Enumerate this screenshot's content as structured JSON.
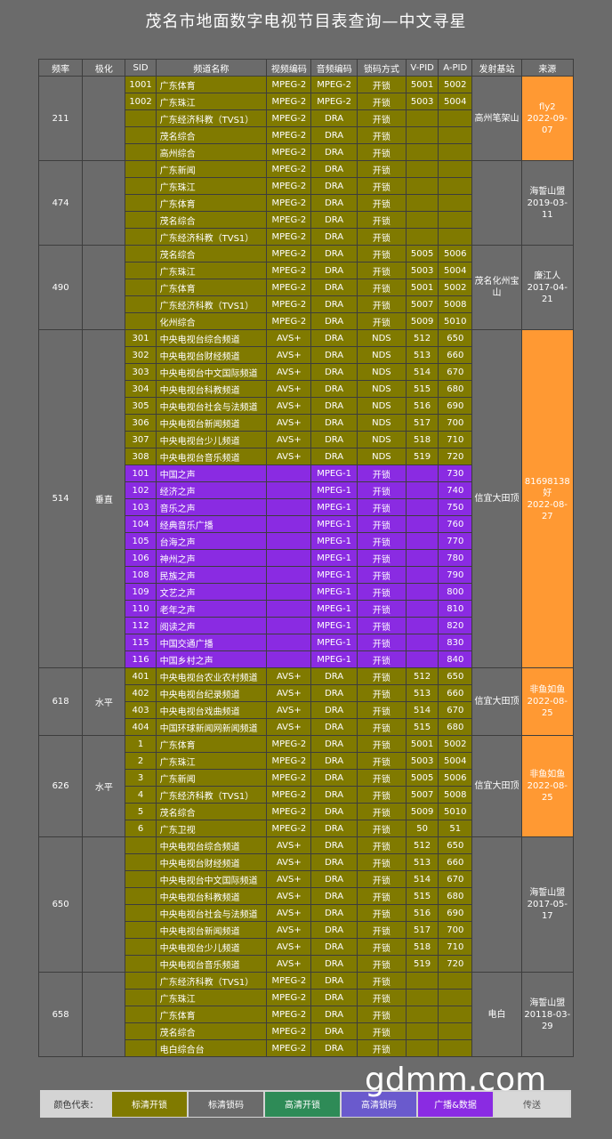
{
  "title": "茂名市地面数字电视节目表查询—中文寻星",
  "headers": [
    "频率",
    "极化",
    "SID",
    "频道名称",
    "视频编码",
    "音频编码",
    "锁码方式",
    "V-PID",
    "A-PID",
    "发射基站",
    "来源"
  ],
  "groups": [
    {
      "freq": "211",
      "pol": "",
      "site": "高州笔架山",
      "source": "fly2\n2022-09-07",
      "source_color": "orange",
      "rows": [
        {
          "t": "olive",
          "sid": "1001",
          "name": "广东体育",
          "v": "MPEG-2",
          "a": "MPEG-2",
          "lock": "开锁",
          "vpid": "5001",
          "apid": "5002"
        },
        {
          "t": "olive",
          "sid": "1002",
          "name": "广东珠江",
          "v": "MPEG-2",
          "a": "MPEG-2",
          "lock": "开锁",
          "vpid": "5003",
          "apid": "5004"
        },
        {
          "t": "olive",
          "sid": "",
          "name": "广东经济科教（TVS1）",
          "v": "MPEG-2",
          "a": "DRA",
          "lock": "开锁",
          "vpid": "",
          "apid": ""
        },
        {
          "t": "olive",
          "sid": "",
          "name": "茂名综合",
          "v": "MPEG-2",
          "a": "DRA",
          "lock": "开锁",
          "vpid": "",
          "apid": ""
        },
        {
          "t": "olive",
          "sid": "",
          "name": "高州综合",
          "v": "MPEG-2",
          "a": "DRA",
          "lock": "开锁",
          "vpid": "",
          "apid": ""
        }
      ]
    },
    {
      "freq": "474",
      "pol": "",
      "site": "",
      "source": "海誓山盟\n2019-03-11",
      "source_color": "gray",
      "rows": [
        {
          "t": "olive",
          "sid": "",
          "name": "广东新闻",
          "v": "MPEG-2",
          "a": "DRA",
          "lock": "开锁",
          "vpid": "",
          "apid": ""
        },
        {
          "t": "olive",
          "sid": "",
          "name": "广东珠江",
          "v": "MPEG-2",
          "a": "DRA",
          "lock": "开锁",
          "vpid": "",
          "apid": ""
        },
        {
          "t": "olive",
          "sid": "",
          "name": "广东体育",
          "v": "MPEG-2",
          "a": "DRA",
          "lock": "开锁",
          "vpid": "",
          "apid": ""
        },
        {
          "t": "olive",
          "sid": "",
          "name": "茂名综合",
          "v": "MPEG-2",
          "a": "DRA",
          "lock": "开锁",
          "vpid": "",
          "apid": ""
        },
        {
          "t": "olive",
          "sid": "",
          "name": "广东经济科教（TVS1）",
          "v": "MPEG-2",
          "a": "DRA",
          "lock": "开锁",
          "vpid": "",
          "apid": ""
        }
      ]
    },
    {
      "freq": "490",
      "pol": "",
      "site": "茂名化州宝山",
      "source": "廉江人\n2017-04-21",
      "source_color": "gray",
      "rows": [
        {
          "t": "olive",
          "sid": "",
          "name": "茂名综合",
          "v": "MPEG-2",
          "a": "DRA",
          "lock": "开锁",
          "vpid": "5005",
          "apid": "5006"
        },
        {
          "t": "olive",
          "sid": "",
          "name": "广东珠江",
          "v": "MPEG-2",
          "a": "DRA",
          "lock": "开锁",
          "vpid": "5003",
          "apid": "5004"
        },
        {
          "t": "olive",
          "sid": "",
          "name": "广东体育",
          "v": "MPEG-2",
          "a": "DRA",
          "lock": "开锁",
          "vpid": "5001",
          "apid": "5002"
        },
        {
          "t": "olive",
          "sid": "",
          "name": "广东经济科教（TVS1）",
          "v": "MPEG-2",
          "a": "DRA",
          "lock": "开锁",
          "vpid": "5007",
          "apid": "5008"
        },
        {
          "t": "olive",
          "sid": "",
          "name": "化州综合",
          "v": "MPEG-2",
          "a": "DRA",
          "lock": "开锁",
          "vpid": "5009",
          "apid": "5010"
        }
      ]
    },
    {
      "freq": "514",
      "pol": "垂直",
      "site": "信宜大田顶",
      "source": "81698138好\n2022-08-27",
      "source_color": "orange",
      "rows": [
        {
          "t": "olive",
          "sid": "301",
          "name": "中央电视台综合频道",
          "v": "AVS+",
          "a": "DRA",
          "lock": "NDS",
          "vpid": "512",
          "apid": "650"
        },
        {
          "t": "olive",
          "sid": "302",
          "name": "中央电视台财经频道",
          "v": "AVS+",
          "a": "DRA",
          "lock": "NDS",
          "vpid": "513",
          "apid": "660"
        },
        {
          "t": "olive",
          "sid": "303",
          "name": "中央电视台中文国际频道",
          "v": "AVS+",
          "a": "DRA",
          "lock": "NDS",
          "vpid": "514",
          "apid": "670"
        },
        {
          "t": "olive",
          "sid": "304",
          "name": "中央电视台科教频道",
          "v": "AVS+",
          "a": "DRA",
          "lock": "NDS",
          "vpid": "515",
          "apid": "680"
        },
        {
          "t": "olive",
          "sid": "305",
          "name": "中央电视台社会与法频道",
          "v": "AVS+",
          "a": "DRA",
          "lock": "NDS",
          "vpid": "516",
          "apid": "690"
        },
        {
          "t": "olive",
          "sid": "306",
          "name": "中央电视台新闻频道",
          "v": "AVS+",
          "a": "DRA",
          "lock": "NDS",
          "vpid": "517",
          "apid": "700"
        },
        {
          "t": "olive",
          "sid": "307",
          "name": "中央电视台少儿频道",
          "v": "AVS+",
          "a": "DRA",
          "lock": "NDS",
          "vpid": "518",
          "apid": "710"
        },
        {
          "t": "olive",
          "sid": "308",
          "name": "中央电视台音乐频道",
          "v": "AVS+",
          "a": "DRA",
          "lock": "NDS",
          "vpid": "519",
          "apid": "720"
        },
        {
          "t": "purple",
          "sid": "101",
          "name": "中国之声",
          "v": "",
          "a": "MPEG-1",
          "lock": "开锁",
          "vpid": "",
          "apid": "730"
        },
        {
          "t": "purple",
          "sid": "102",
          "name": "经济之声",
          "v": "",
          "a": "MPEG-1",
          "lock": "开锁",
          "vpid": "",
          "apid": "740"
        },
        {
          "t": "purple",
          "sid": "103",
          "name": "音乐之声",
          "v": "",
          "a": "MPEG-1",
          "lock": "开锁",
          "vpid": "",
          "apid": "750"
        },
        {
          "t": "purple",
          "sid": "104",
          "name": "经典音乐广播",
          "v": "",
          "a": "MPEG-1",
          "lock": "开锁",
          "vpid": "",
          "apid": "760"
        },
        {
          "t": "purple",
          "sid": "105",
          "name": "台海之声",
          "v": "",
          "a": "MPEG-1",
          "lock": "开锁",
          "vpid": "",
          "apid": "770"
        },
        {
          "t": "purple",
          "sid": "106",
          "name": "神州之声",
          "v": "",
          "a": "MPEG-1",
          "lock": "开锁",
          "vpid": "",
          "apid": "780"
        },
        {
          "t": "purple",
          "sid": "108",
          "name": "民族之声",
          "v": "",
          "a": "MPEG-1",
          "lock": "开锁",
          "vpid": "",
          "apid": "790"
        },
        {
          "t": "purple",
          "sid": "109",
          "name": "文艺之声",
          "v": "",
          "a": "MPEG-1",
          "lock": "开锁",
          "vpid": "",
          "apid": "800"
        },
        {
          "t": "purple",
          "sid": "110",
          "name": "老年之声",
          "v": "",
          "a": "MPEG-1",
          "lock": "开锁",
          "vpid": "",
          "apid": "810"
        },
        {
          "t": "purple",
          "sid": "112",
          "name": "阅读之声",
          "v": "",
          "a": "MPEG-1",
          "lock": "开锁",
          "vpid": "",
          "apid": "820"
        },
        {
          "t": "purple",
          "sid": "115",
          "name": "中国交通广播",
          "v": "",
          "a": "MPEG-1",
          "lock": "开锁",
          "vpid": "",
          "apid": "830"
        },
        {
          "t": "purple",
          "sid": "116",
          "name": "中国乡村之声",
          "v": "",
          "a": "MPEG-1",
          "lock": "开锁",
          "vpid": "",
          "apid": "840"
        }
      ]
    },
    {
      "freq": "618",
      "pol": "水平",
      "site": "信宜大田顶",
      "source": "非鱼如鱼\n2022-08-25",
      "source_color": "orange",
      "rows": [
        {
          "t": "olive",
          "sid": "401",
          "name": "中央电视台农业农村频道",
          "v": "AVS+",
          "a": "DRA",
          "lock": "开锁",
          "vpid": "512",
          "apid": "650"
        },
        {
          "t": "olive",
          "sid": "402",
          "name": "中央电视台纪录频道",
          "v": "AVS+",
          "a": "DRA",
          "lock": "开锁",
          "vpid": "513",
          "apid": "660"
        },
        {
          "t": "olive",
          "sid": "403",
          "name": "中央电视台戏曲频道",
          "v": "AVS+",
          "a": "DRA",
          "lock": "开锁",
          "vpid": "514",
          "apid": "670"
        },
        {
          "t": "olive",
          "sid": "404",
          "name": "中国环球新闻网新闻频道",
          "v": "AVS+",
          "a": "DRA",
          "lock": "开锁",
          "vpid": "515",
          "apid": "680"
        }
      ]
    },
    {
      "freq": "626",
      "pol": "水平",
      "site": "信宜大田顶",
      "source": "非鱼如鱼\n2022-08-25",
      "source_color": "orange",
      "rows": [
        {
          "t": "olive",
          "sid": "1",
          "name": "广东体育",
          "v": "MPEG-2",
          "a": "DRA",
          "lock": "开锁",
          "vpid": "5001",
          "apid": "5002"
        },
        {
          "t": "olive",
          "sid": "2",
          "name": "广东珠江",
          "v": "MPEG-2",
          "a": "DRA",
          "lock": "开锁",
          "vpid": "5003",
          "apid": "5004"
        },
        {
          "t": "olive",
          "sid": "3",
          "name": "广东新闻",
          "v": "MPEG-2",
          "a": "DRA",
          "lock": "开锁",
          "vpid": "5005",
          "apid": "5006"
        },
        {
          "t": "olive",
          "sid": "4",
          "name": "广东经济科教（TVS1）",
          "v": "MPEG-2",
          "a": "DRA",
          "lock": "开锁",
          "vpid": "5007",
          "apid": "5008"
        },
        {
          "t": "olive",
          "sid": "5",
          "name": "茂名综合",
          "v": "MPEG-2",
          "a": "DRA",
          "lock": "开锁",
          "vpid": "5009",
          "apid": "5010"
        },
        {
          "t": "olive",
          "sid": "6",
          "name": "广东卫视",
          "v": "MPEG-2",
          "a": "DRA",
          "lock": "开锁",
          "vpid": "50",
          "apid": "51"
        }
      ]
    },
    {
      "freq": "650",
      "pol": "",
      "site": "",
      "source": "海誓山盟\n2017-05-17",
      "source_color": "gray",
      "rows": [
        {
          "t": "olive",
          "sid": "",
          "name": "中央电视台综合频道",
          "v": "AVS+",
          "a": "DRA",
          "lock": "开锁",
          "vpid": "512",
          "apid": "650"
        },
        {
          "t": "olive",
          "sid": "",
          "name": "中央电视台财经频道",
          "v": "AVS+",
          "a": "DRA",
          "lock": "开锁",
          "vpid": "513",
          "apid": "660"
        },
        {
          "t": "olive",
          "sid": "",
          "name": "中央电视台中文国际频道",
          "v": "AVS+",
          "a": "DRA",
          "lock": "开锁",
          "vpid": "514",
          "apid": "670"
        },
        {
          "t": "olive",
          "sid": "",
          "name": "中央电视台科教频道",
          "v": "AVS+",
          "a": "DRA",
          "lock": "开锁",
          "vpid": "515",
          "apid": "680"
        },
        {
          "t": "olive",
          "sid": "",
          "name": "中央电视台社会与法频道",
          "v": "AVS+",
          "a": "DRA",
          "lock": "开锁",
          "vpid": "516",
          "apid": "690"
        },
        {
          "t": "olive",
          "sid": "",
          "name": "中央电视台新闻频道",
          "v": "AVS+",
          "a": "DRA",
          "lock": "开锁",
          "vpid": "517",
          "apid": "700"
        },
        {
          "t": "olive",
          "sid": "",
          "name": "中央电视台少儿频道",
          "v": "AVS+",
          "a": "DRA",
          "lock": "开锁",
          "vpid": "518",
          "apid": "710"
        },
        {
          "t": "olive",
          "sid": "",
          "name": "中央电视台音乐频道",
          "v": "AVS+",
          "a": "DRA",
          "lock": "开锁",
          "vpid": "519",
          "apid": "720"
        }
      ]
    },
    {
      "freq": "658",
      "pol": "",
      "site": "电白",
      "source": "海誓山盟\n20118-03-\n29",
      "source_color": "gray",
      "rows": [
        {
          "t": "olive",
          "sid": "",
          "name": "广东经济科教（TVS1）",
          "v": "MPEG-2",
          "a": "DRA",
          "lock": "开锁",
          "vpid": "",
          "apid": ""
        },
        {
          "t": "olive",
          "sid": "",
          "name": "广东珠江",
          "v": "MPEG-2",
          "a": "DRA",
          "lock": "开锁",
          "vpid": "",
          "apid": ""
        },
        {
          "t": "olive",
          "sid": "",
          "name": "广东体育",
          "v": "MPEG-2",
          "a": "DRA",
          "lock": "开锁",
          "vpid": "",
          "apid": ""
        },
        {
          "t": "olive",
          "sid": "",
          "name": "茂名综合",
          "v": "MPEG-2",
          "a": "DRA",
          "lock": "开锁",
          "vpid": "",
          "apid": ""
        },
        {
          "t": "olive",
          "sid": "",
          "name": "电白综合台",
          "v": "MPEG-2",
          "a": "DRA",
          "lock": "开锁",
          "vpid": "",
          "apid": ""
        }
      ]
    }
  ],
  "legend": {
    "label": "颜色代表：",
    "items": [
      {
        "text": "标清开锁",
        "bg": "#807a00",
        "fg": "#ffffff"
      },
      {
        "text": "标清锁码",
        "bg": "#6b6b6b",
        "fg": "#ffffff"
      },
      {
        "text": "高清开锁",
        "bg": "#2e8b57",
        "fg": "#ffffff"
      },
      {
        "text": "高清锁码",
        "bg": "#6a5acd",
        "fg": "#ffffff"
      },
      {
        "text": "广播&数据",
        "bg": "#8a2be2",
        "fg": "#ffffff"
      },
      {
        "text": "传送",
        "bg": "#d8d8d8",
        "fg": "#555555"
      }
    ]
  },
  "watermark": "gdmm.com",
  "colors": {
    "olive": "#807a00",
    "purple": "#8a2be2",
    "orange": "#ff9933",
    "bg": "#6b6b6b"
  }
}
